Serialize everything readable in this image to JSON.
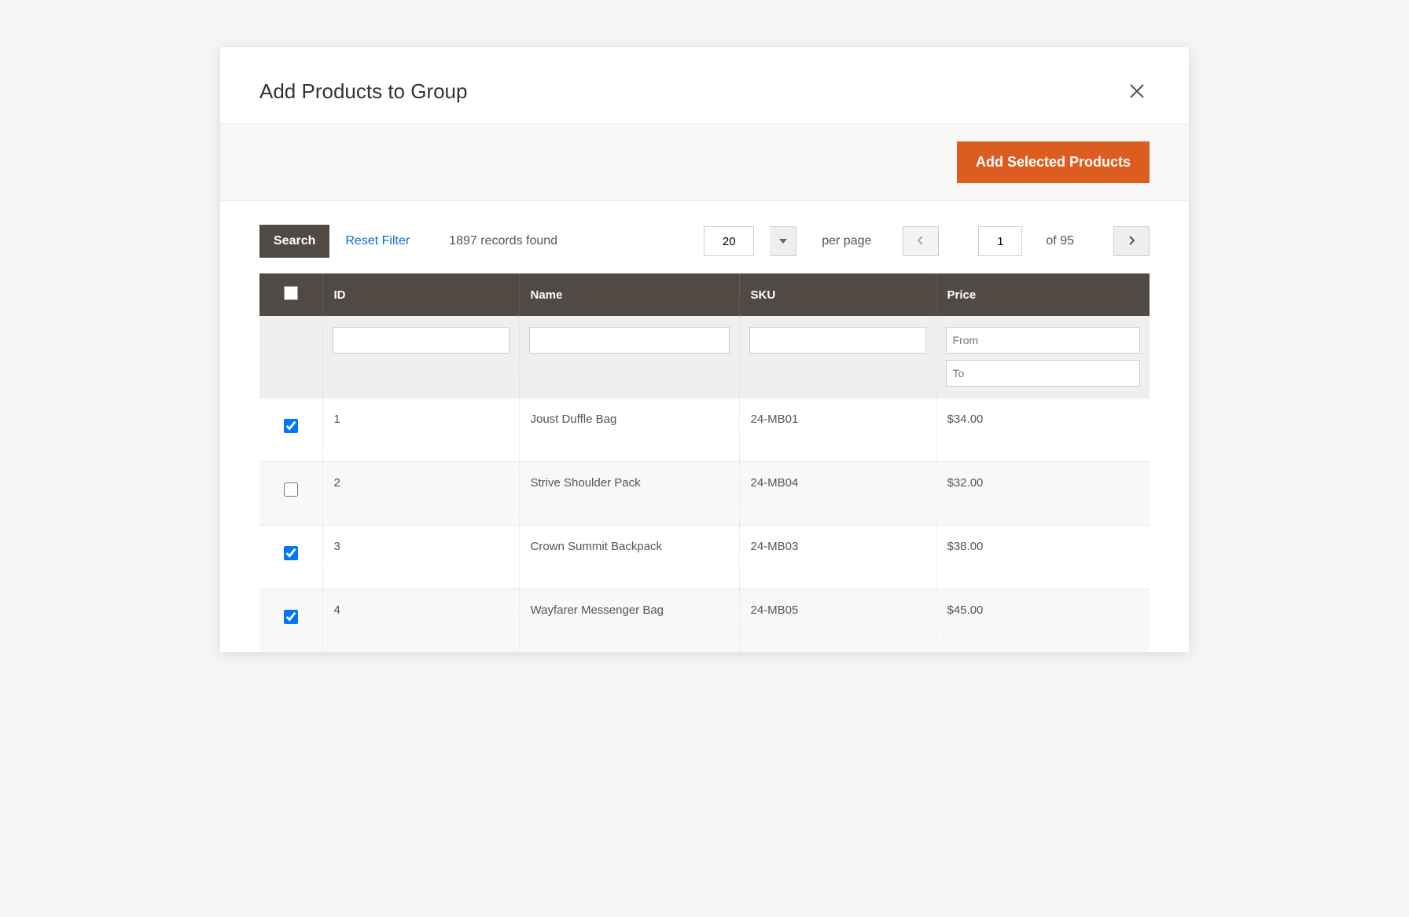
{
  "modal": {
    "title": "Add Products to Group",
    "add_button_label": "Add Selected Products"
  },
  "toolbar": {
    "search_label": "Search",
    "reset_label": "Reset Filter",
    "records_found": "1897 records found",
    "page_size": "20",
    "per_page_label": "per page",
    "current_page": "1",
    "of_pages": "of 95"
  },
  "headers": {
    "id": "ID",
    "name": "Name",
    "sku": "SKU",
    "price": "Price"
  },
  "filters": {
    "price_from_placeholder": "From",
    "price_to_placeholder": "To"
  },
  "rows": [
    {
      "checked": true,
      "id": "1",
      "name": "Joust Duffle Bag",
      "sku": "24-MB01",
      "price": "$34.00"
    },
    {
      "checked": false,
      "id": "2",
      "name": "Strive Shoulder Pack",
      "sku": "24-MB04",
      "price": "$32.00"
    },
    {
      "checked": true,
      "id": "3",
      "name": "Crown Summit Backpack",
      "sku": "24-MB03",
      "price": "$38.00"
    },
    {
      "checked": true,
      "id": "4",
      "name": "Wayfarer Messenger Bag",
      "sku": "24-MB05",
      "price": "$45.00"
    }
  ]
}
